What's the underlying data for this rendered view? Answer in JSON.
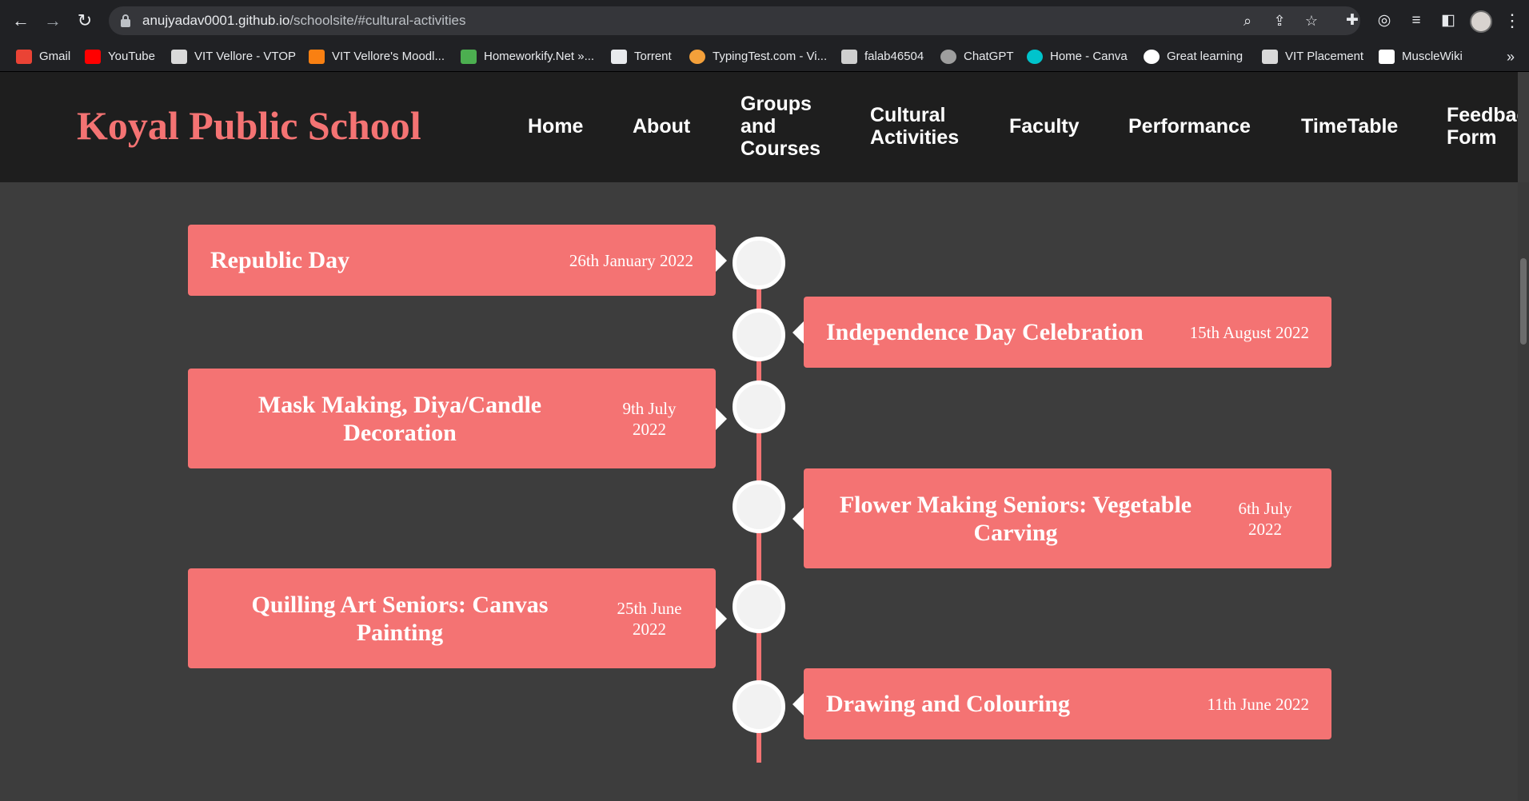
{
  "browser": {
    "url_host": "anujyadav0001.github.io",
    "url_path": "/schoolsite/#cultural-activities",
    "nav_icons": [
      "back-arrow-icon",
      "forward-arrow-icon",
      "reload-icon"
    ],
    "bookmarks": [
      {
        "label": "Gmail",
        "icon": "gmail-icon",
        "color": "#ea4335"
      },
      {
        "label": "YouTube",
        "icon": "youtube-icon",
        "color": "#ff0000"
      },
      {
        "label": "VIT Vellore - VTOP",
        "icon": "vtop-icon",
        "color": "#d9d9d9"
      },
      {
        "label": "VIT Vellore's Moodl...",
        "icon": "moodle-icon",
        "color": "#f98012"
      },
      {
        "label": "Homeworkify.Net »...",
        "icon": "homeworkify-icon",
        "color": "#4caf50"
      },
      {
        "label": "Torrent",
        "icon": "torrent-icon",
        "color": "#e8eaed"
      },
      {
        "label": "TypingTest.com - Vi...",
        "icon": "typingtest-icon",
        "color": "#f4a03a"
      },
      {
        "label": "falab46504",
        "icon": "document-icon",
        "color": "#cfcfcf"
      },
      {
        "label": "ChatGPT",
        "icon": "chatgpt-icon",
        "color": "#9e9e9e"
      },
      {
        "label": "Home - Canva",
        "icon": "canva-icon",
        "color": "#00c4cc"
      },
      {
        "label": "Great learning",
        "icon": "google-icon",
        "color": "#ffffff"
      },
      {
        "label": "VIT Placement",
        "icon": "vit-placement-icon",
        "color": "#d9d9d9"
      },
      {
        "label": "MuscleWiki",
        "icon": "musclewiki-icon",
        "color": "#ffffff"
      }
    ]
  },
  "header": {
    "logo": "Koyal Public School",
    "menu": [
      "Home",
      "About",
      "Groups and Courses",
      "Cultural Activities",
      "Faculty",
      "Performance",
      "TimeTable",
      "Feedback Form"
    ]
  },
  "timeline": [
    {
      "title": "Republic Day",
      "date": "26th January 2022",
      "side": "left"
    },
    {
      "title": "Independence Day Celebration",
      "date": "15th August 2022",
      "side": "right"
    },
    {
      "title": "Mask Making, Diya/Candle Decoration",
      "date": "9th July 2022",
      "side": "left"
    },
    {
      "title": "Flower Making Seniors: Vegetable Carving",
      "date": "6th July 2022",
      "side": "right"
    },
    {
      "title": "Quilling Art Seniors: Canvas Painting",
      "date": "25th June 2022",
      "side": "left"
    },
    {
      "title": "Drawing and Colouring",
      "date": "11th June 2022",
      "side": "right"
    }
  ],
  "colors": {
    "accent": "#f47373",
    "header_bg": "#1e1e1e",
    "page_bg": "#3d3d3d"
  }
}
